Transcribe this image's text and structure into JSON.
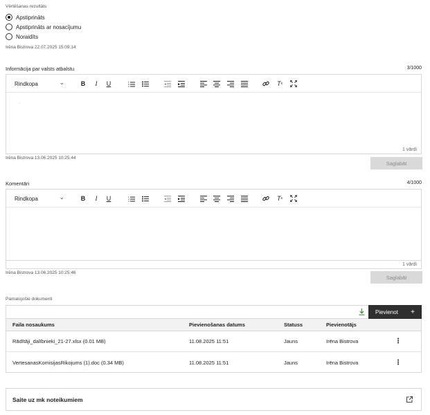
{
  "evaluation": {
    "section_label": "Vērtēšanas rezultāts",
    "options": [
      {
        "label": "Apstiprināts",
        "selected": true
      },
      {
        "label": "Apstiprināts ar nosacījumu",
        "selected": false
      },
      {
        "label": "Noraidīts",
        "selected": false
      }
    ],
    "meta": "Irēna Bistrova 22.07.2025 15:09:14"
  },
  "info_editor": {
    "label": "Informācija par valsts atbalstu",
    "char_count": "3/1000",
    "format_select": "Rindkopa",
    "content": "·",
    "word_count": "1 vārdi",
    "meta": "Irēna Bistrova 13.06.2025 10:25:44",
    "save_label": "Saglabāt"
  },
  "comments_editor": {
    "label": "Komentāri",
    "char_count": "4/1000",
    "format_select": "Rindkopa",
    "content": "",
    "word_count": "1 vārdi",
    "meta": "Irēna Bistrova 13.06.2025 10:25:46",
    "save_label": "Saglabāt"
  },
  "documents": {
    "label": "Pamatojošie dokumenti",
    "add_label": "Pievienot",
    "add_icon": "plus-icon",
    "download_icon": "download-icon",
    "columns": [
      "Faila nosaukums",
      "Pievienošanas datums",
      "Statuss",
      "Pievienotājs"
    ],
    "rows": [
      {
        "name": "Rādītāji_dalībnieki_21-27.xlsx (0.01 MB)",
        "date": "11.08.2025 11:51",
        "status": "Jauns",
        "user": "Irēna Bistrova"
      },
      {
        "name": "VertesanasKomisijasRikojums (1).doc (0.34 MB)",
        "date": "11.08.2025 11:51",
        "status": "Jauns",
        "user": "Irēna Bistrova"
      }
    ]
  },
  "link": {
    "label": "Saite uz mk noteikumiem",
    "icon": "external-link-icon"
  },
  "colors": {
    "button_dark": "#2f2f2f",
    "button_disabled": "#d9d9d9",
    "download_icon": "#3a8a3a"
  }
}
